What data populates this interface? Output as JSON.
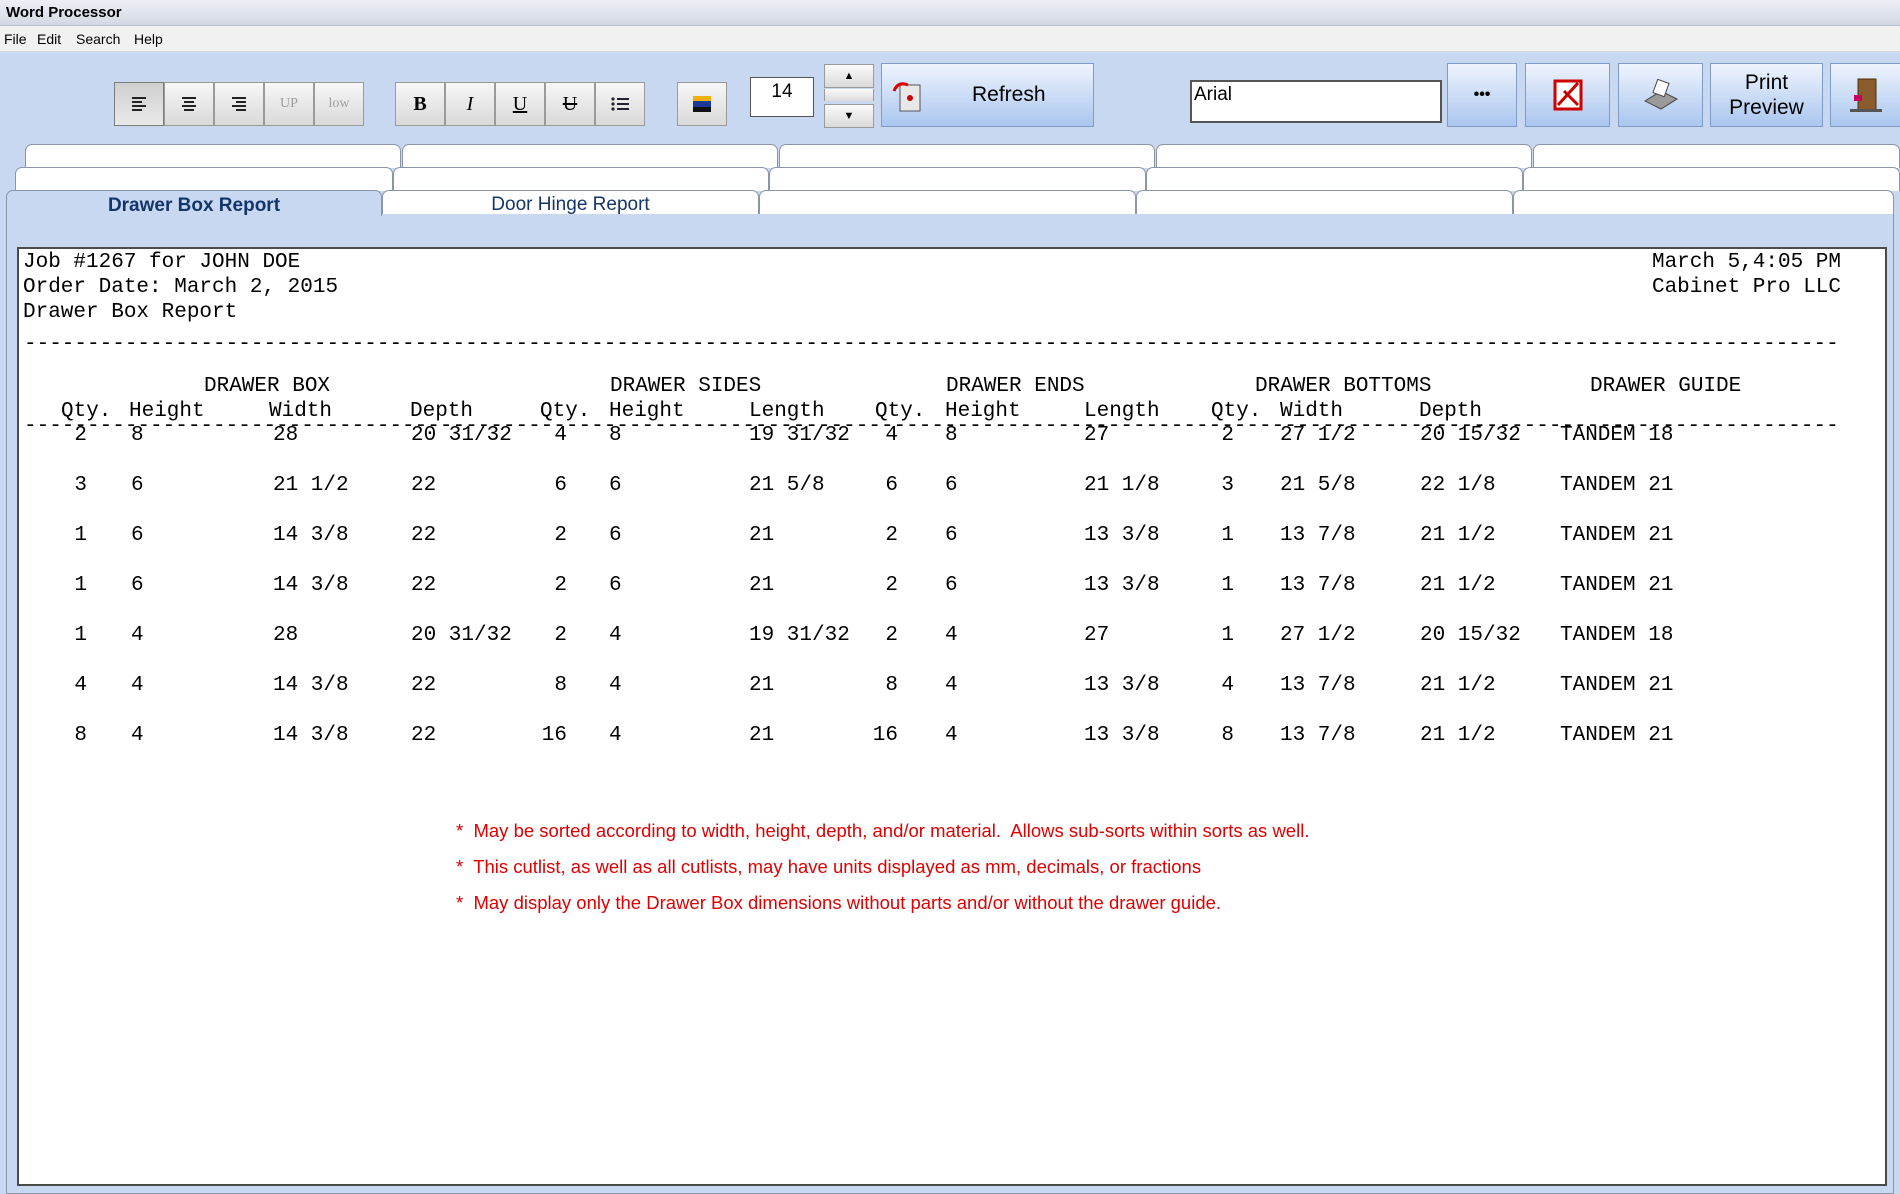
{
  "window": {
    "title": "Word Processor"
  },
  "menu": [
    "File",
    "Edit",
    "Search",
    "Help"
  ],
  "toolbar": {
    "format_buttons": [
      {
        "name": "align-left-button",
        "label": "",
        "icon": "align-left-icon"
      },
      {
        "name": "align-center-button",
        "label": "",
        "icon": "align-center-icon"
      },
      {
        "name": "align-right-button",
        "label": "",
        "icon": "align-right-icon"
      },
      {
        "name": "uppercase-button",
        "label": "UP",
        "icon": ""
      },
      {
        "name": "lowercase-button",
        "label": "low",
        "icon": ""
      }
    ],
    "style_buttons": [
      {
        "name": "bold-button",
        "label": "B"
      },
      {
        "name": "italic-button",
        "label": "I"
      },
      {
        "name": "underline-button",
        "label": "U"
      },
      {
        "name": "strikethrough-button",
        "label": "U"
      },
      {
        "name": "bullet-list-button",
        "label": ""
      }
    ],
    "font_size": "14",
    "spin_up": "▲",
    "spin_down": "▼",
    "refresh_label": "Refresh",
    "font_name": "Arial",
    "more_label": "•••",
    "print_preview_label_1": "Print",
    "print_preview_label_2": "Preview",
    "icons": [
      "color-icon",
      "refresh-icon",
      "pdf-icon",
      "printer-icon",
      "exit-door-icon"
    ]
  },
  "tabs": {
    "row3": [
      "Drawer Box Report",
      "Door Hinge Report",
      "",
      "",
      ""
    ],
    "selected": "Drawer Box Report"
  },
  "report": {
    "job_line": "Job #1267 for JOHN DOE",
    "order_line": "Order Date: March 2, 2015",
    "report_title": "Drawer Box Report",
    "date_time": "March 5,4:05 PM",
    "company": "Cabinet Pro LLC",
    "separator": "-------------------------------------------------------------------------------------------------------------------------------------------------------------------------",
    "group_headers": [
      "DRAWER BOX",
      "DRAWER SIDES",
      "DRAWER ENDS",
      "DRAWER BOTTOMS",
      "DRAWER GUIDE"
    ],
    "columns": [
      "Qty.",
      "Height",
      "Width",
      "Depth",
      "Qty.",
      "Height",
      "Length",
      "Qty.",
      "Height",
      "Length",
      "Qty.",
      "Width",
      "Depth"
    ],
    "rows": [
      [
        "2",
        "8",
        "28",
        "20 31/32",
        "4",
        "8",
        "19 31/32",
        "4",
        "8",
        "27",
        "2",
        "27 1/2",
        "20 15/32",
        "TANDEM 18"
      ],
      [
        "3",
        "6",
        "21 1/2",
        "22",
        "6",
        "6",
        "21 5/8",
        "6",
        "6",
        "21 1/8",
        "3",
        "21 5/8",
        "22 1/8",
        "TANDEM 21"
      ],
      [
        "1",
        "6",
        "14 3/8",
        "22",
        "2",
        "6",
        "21",
        "2",
        "6",
        "13 3/8",
        "1",
        "13 7/8",
        "21 1/2",
        "TANDEM 21"
      ],
      [
        "1",
        "6",
        "14 3/8",
        "22",
        "2",
        "6",
        "21",
        "2",
        "6",
        "13 3/8",
        "1",
        "13 7/8",
        "21 1/2",
        "TANDEM 21"
      ],
      [
        "1",
        "4",
        "28",
        "20 31/32",
        "2",
        "4",
        "19 31/32",
        "2",
        "4",
        "27",
        "1",
        "27 1/2",
        "20 15/32",
        "TANDEM 18"
      ],
      [
        "4",
        "4",
        "14 3/8",
        "22",
        "8",
        "4",
        "21",
        "8",
        "4",
        "13 3/8",
        "4",
        "13 7/8",
        "21 1/2",
        "TANDEM 21"
      ],
      [
        "8",
        "4",
        "14 3/8",
        "22",
        "16",
        "4",
        "21",
        "16",
        "4",
        "13 3/8",
        "8",
        "13 7/8",
        "21 1/2",
        "TANDEM 21"
      ]
    ],
    "notes": [
      "*  May be sorted according to width, height, depth, and/or material.  Allows sub-sorts within sorts as well.",
      "*  This cutlist, as well as all cutlists, may have units displayed as mm, decimals, or fractions",
      "*  May display only the Drawer Box dimensions without parts and/or without the drawer guide."
    ]
  }
}
